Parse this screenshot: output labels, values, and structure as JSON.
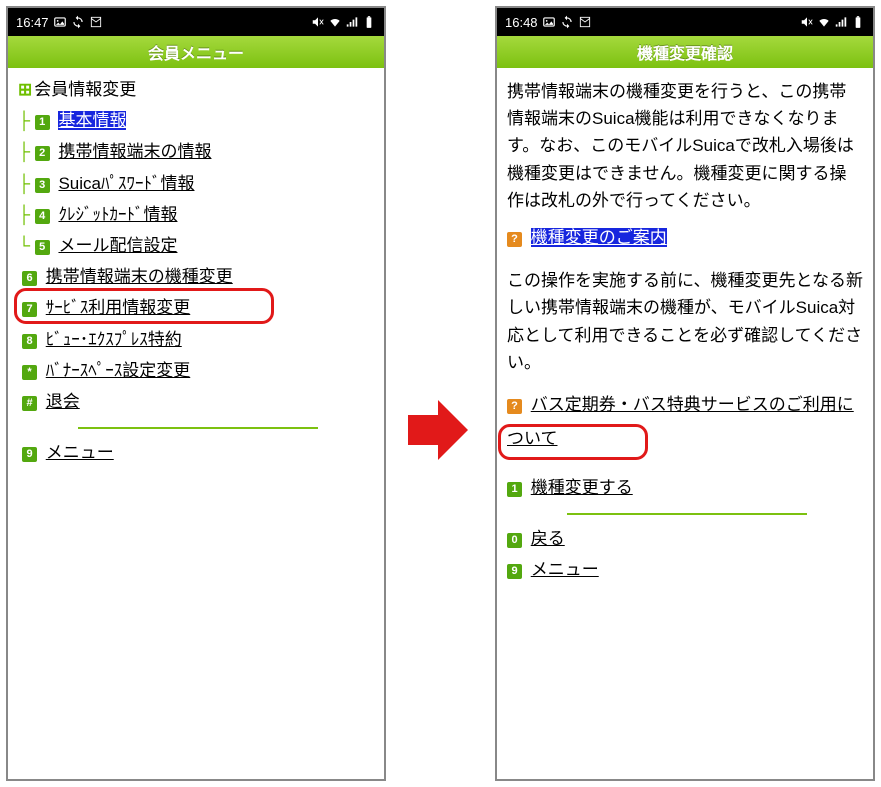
{
  "left": {
    "status": {
      "time": "16:47"
    },
    "title": "会員メニュー",
    "section_header": "会員情報変更",
    "items": [
      {
        "num": "1",
        "label": "基本情報",
        "highlight": true
      },
      {
        "num": "2",
        "label": "携帯情報端末の情報"
      },
      {
        "num": "3",
        "label": "Suicaﾊﾟｽﾜｰﾄﾞ情報"
      },
      {
        "num": "4",
        "label": "ｸﾚｼﾞｯﾄｶｰﾄﾞ情報"
      },
      {
        "num": "5",
        "label": "メール配信設定"
      },
      {
        "num": "6",
        "label": "携帯情報端末の機種変更"
      },
      {
        "num": "7",
        "label": "ｻｰﾋﾞｽ利用情報変更"
      },
      {
        "num": "8",
        "label": "ﾋﾞｭｰ･ｴｸｽﾌﾟﾚｽ特約"
      },
      {
        "num": "*",
        "label": "ﾊﾞﾅｰｽﾍﾟｰｽ設定変更"
      },
      {
        "num": "#",
        "label": "退会"
      }
    ],
    "bottom_link": {
      "num": "9",
      "label": "メニュー"
    }
  },
  "right": {
    "status": {
      "time": "16:48"
    },
    "title": "機種変更確認",
    "paragraph1": "携帯情報端末の機種変更を行うと、この携帯情報端末のSuica機能は利用できなくなります。なお、このモバイルSuicaで改札入場後は機種変更はできません。機種変更に関する操作は改札の外で行ってください。",
    "guide_link": {
      "num": "?",
      "label": "機種変更のご案内"
    },
    "paragraph2": "この操作を実施する前に、機種変更先となる新しい携帯情報端末の機種が、モバイルSuica対応として利用できることを必ず確認してください。",
    "bus_link": {
      "num": "?",
      "label": "バス定期券・バス特典サービスのご利用について"
    },
    "action_link": {
      "num": "1",
      "label": "機種変更する"
    },
    "back_link": {
      "num": "0",
      "label": "戻る"
    },
    "menu_link": {
      "num": "9",
      "label": "メニュー"
    }
  }
}
